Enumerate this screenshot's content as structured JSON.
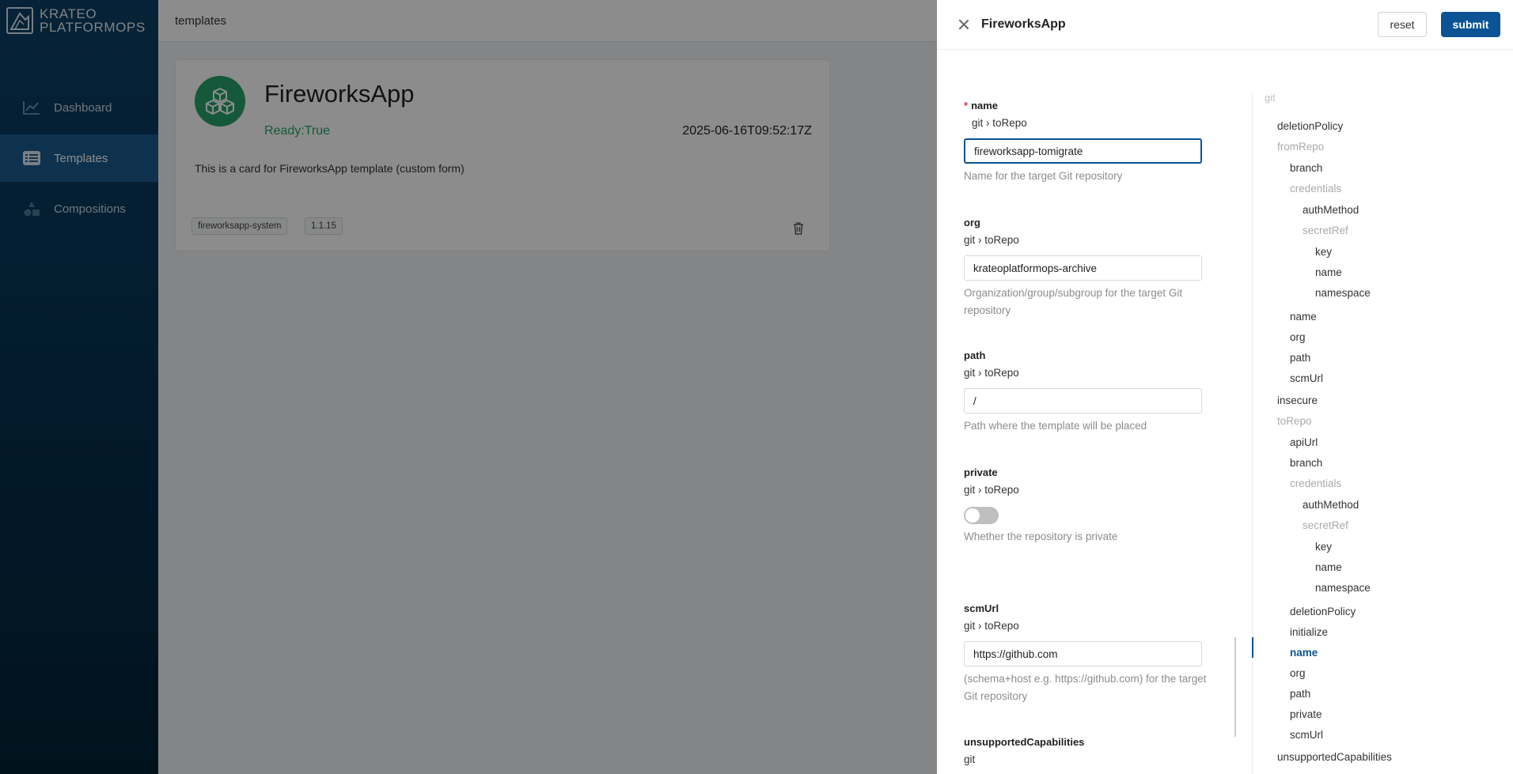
{
  "sidebar": {
    "logo_line1": "KRATEO",
    "logo_line2": "PLATFORMOPS",
    "items": [
      {
        "label": "Dashboard",
        "icon": "chart-line-icon"
      },
      {
        "label": "Templates",
        "icon": "list-icon",
        "active": true
      },
      {
        "label": "Compositions",
        "icon": "shapes-icon"
      }
    ]
  },
  "header": {
    "breadcrumb": "templates"
  },
  "card": {
    "title": "FireworksApp",
    "status": "Ready:True",
    "date": "2025-06-16T09:52:17Z",
    "description": "This is a card for FireworksApp template (custom form)",
    "tags": [
      "fireworksapp-system",
      "1.1.15"
    ]
  },
  "drawer": {
    "title": "FireworksApp",
    "reset_label": "reset",
    "submit_label": "submit",
    "fields": [
      {
        "label": "name",
        "required": true,
        "path": "git ›  toRepo",
        "value": "fireworksapp-tomigrate",
        "help": "Name for the target Git repository"
      },
      {
        "label": "org",
        "path": "git ›  toRepo",
        "value": "krateoplatformops-archive",
        "help": "Organization/group/subgroup for the target Git repository"
      },
      {
        "label": "path",
        "path": "git ›  toRepo",
        "value": "/",
        "help": "Path where the template will be placed"
      },
      {
        "label": "private",
        "path": "git ›  toRepo",
        "value": "off",
        "help": "Whether the repository is private"
      },
      {
        "label": "scmUrl",
        "path": "git ›  toRepo",
        "value": "https://github.com",
        "help": "(schema+host e.g. https://github.com) for the target Git repository"
      },
      {
        "label": "unsupportedCapabilities",
        "path": "git"
      }
    ],
    "tree": {
      "top": "git",
      "nodes": [
        {
          "label": "deletionPolicy",
          "depth": 1
        },
        {
          "label": "fromRepo",
          "depth": 1,
          "group": true
        },
        {
          "label": "branch",
          "depth": 2
        },
        {
          "label": "credentials",
          "depth": 2,
          "group": true
        },
        {
          "label": "authMethod",
          "depth": 3
        },
        {
          "label": "secretRef",
          "depth": 3,
          "group": true
        },
        {
          "label": "key",
          "depth": 4
        },
        {
          "label": "name",
          "depth": 4
        },
        {
          "label": "namespace",
          "depth": 4
        },
        {
          "label": "name",
          "depth": 2
        },
        {
          "label": "org",
          "depth": 2
        },
        {
          "label": "path",
          "depth": 2
        },
        {
          "label": "scmUrl",
          "depth": 2
        },
        {
          "label": "insecure",
          "depth": 1
        },
        {
          "label": "toRepo",
          "depth": 1,
          "group": true
        },
        {
          "label": "apiUrl",
          "depth": 2
        },
        {
          "label": "branch",
          "depth": 2
        },
        {
          "label": "credentials",
          "depth": 2,
          "group": true
        },
        {
          "label": "authMethod",
          "depth": 3
        },
        {
          "label": "secretRef",
          "depth": 3,
          "group": true
        },
        {
          "label": "key",
          "depth": 4
        },
        {
          "label": "name",
          "depth": 4
        },
        {
          "label": "namespace",
          "depth": 4
        },
        {
          "label": "deletionPolicy",
          "depth": 2
        },
        {
          "label": "initialize",
          "depth": 2
        },
        {
          "label": "name",
          "depth": 2,
          "active": true
        },
        {
          "label": "org",
          "depth": 2
        },
        {
          "label": "path",
          "depth": 2
        },
        {
          "label": "private",
          "depth": 2
        },
        {
          "label": "scmUrl",
          "depth": 2
        },
        {
          "label": "unsupportedCapabilities",
          "depth": 1
        }
      ]
    }
  }
}
